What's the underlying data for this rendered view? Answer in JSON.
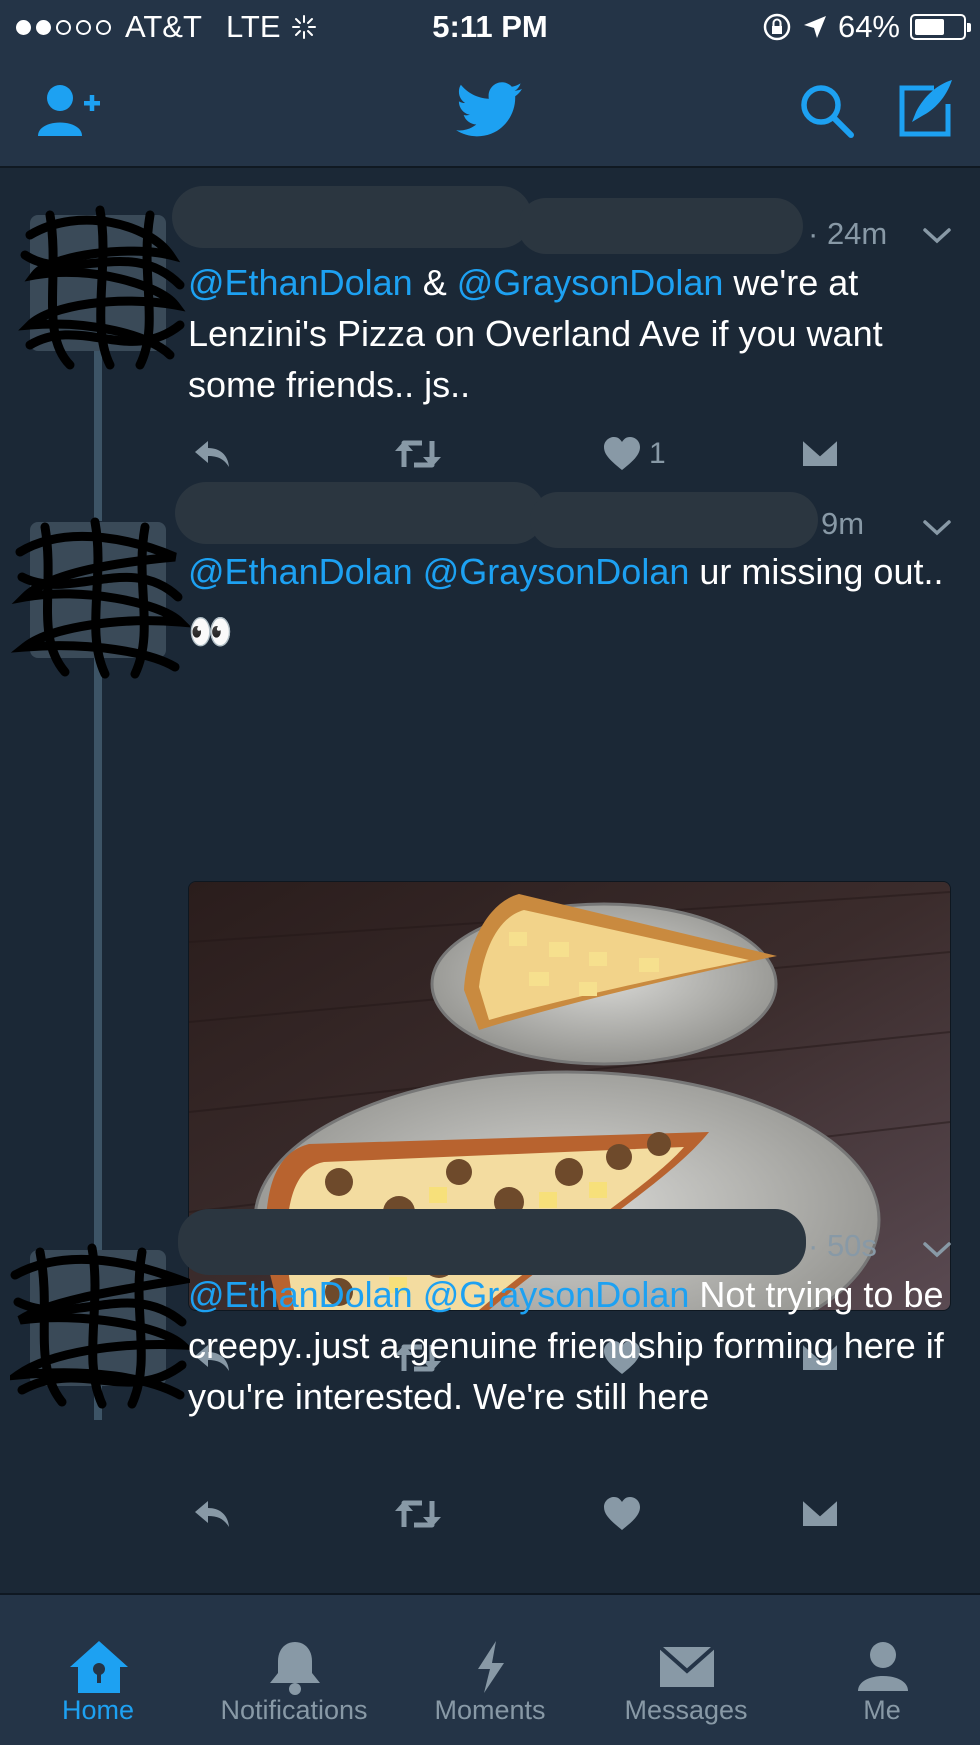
{
  "status_bar": {
    "carrier": "AT&T",
    "network": "LTE",
    "time": "5:11 PM",
    "battery": "64%",
    "battery_level": 0.64,
    "signal_dots_filled": 2,
    "signal_dots_total": 5
  },
  "nav": {
    "icons": [
      "add-user-icon",
      "twitter-bird-icon",
      "search-icon",
      "compose-icon"
    ]
  },
  "tweets": [
    {
      "time": "24m",
      "mentions": [
        "@EthanDolan",
        "@GraysonDolan"
      ],
      "joiner": " & ",
      "text": " we're at Lenzini's Pizza on Overland Ave if you want some friends.. js..",
      "likes": "1"
    },
    {
      "time": "9m",
      "mentions": [
        "@EthanDolan",
        "@GraysonDolan"
      ],
      "joiner": " ",
      "text": " ur missing out.. 👀",
      "likes": ""
    },
    {
      "time": "50s",
      "mentions": [
        "@EthanDolan",
        "@GraysonDolan"
      ],
      "joiner": " ",
      "text": " Not trying to be creepy..just a genuine friendship forming here if you're interested. We're still here",
      "likes": ""
    }
  ],
  "tabs": [
    {
      "label": "Home",
      "icon": "home-icon",
      "active": true
    },
    {
      "label": "Notifications",
      "icon": "bell-icon",
      "active": false
    },
    {
      "label": "Moments",
      "icon": "lightning-icon",
      "active": false
    },
    {
      "label": "Messages",
      "icon": "envelope-icon",
      "active": false
    },
    {
      "label": "Me",
      "icon": "person-icon",
      "active": false
    }
  ],
  "colors": {
    "background": "#1b2836",
    "bar": "#243447",
    "accent": "#1da1f2",
    "muted": "#8899a6"
  }
}
